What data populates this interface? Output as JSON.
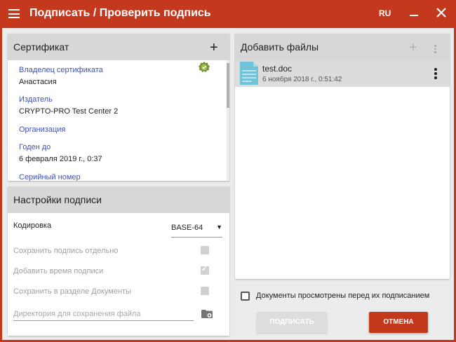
{
  "app": {
    "title": "Подписать / Проверить подпись",
    "language": "RU",
    "accent_color": "#c4391e"
  },
  "certificate": {
    "header": "Сертификат",
    "add_symbol": "+",
    "status_icon": "valid-certificate-badge-icon",
    "fields": [
      {
        "label": "Владелец сертификата",
        "value": "Анастасия"
      },
      {
        "label": "Издатель",
        "value": "CRYPTO-PRO Test Center 2"
      },
      {
        "label": "Организация",
        "value": ""
      },
      {
        "label": "Годен до",
        "value": "6 февраля 2019 г., 0:37"
      },
      {
        "label": "Серийный номер",
        "value": ""
      }
    ]
  },
  "settings": {
    "header": "Настройки подписи",
    "encoding_label": "Кодировка",
    "encoding_value": "BASE-64",
    "options": [
      {
        "label": "Сохранить подпись отдельно",
        "checked": false
      },
      {
        "label": "Добавить время подписи",
        "checked": true
      },
      {
        "label": "Сохранить в разделе Документы",
        "checked": false
      }
    ],
    "directory_placeholder": "Директория для сохранения файла"
  },
  "files": {
    "header": "Добавить файлы",
    "add_symbol": "+",
    "items": [
      {
        "name": "test.doc",
        "date": "6 ноября 2018 г., 0:51:42",
        "icon": "doc-file-icon"
      }
    ]
  },
  "footer": {
    "reviewed_label": "Документы просмотрены перед их подписанием",
    "sign_button": "ПОДПИСАТЬ",
    "cancel_button": "ОТМЕНА"
  }
}
